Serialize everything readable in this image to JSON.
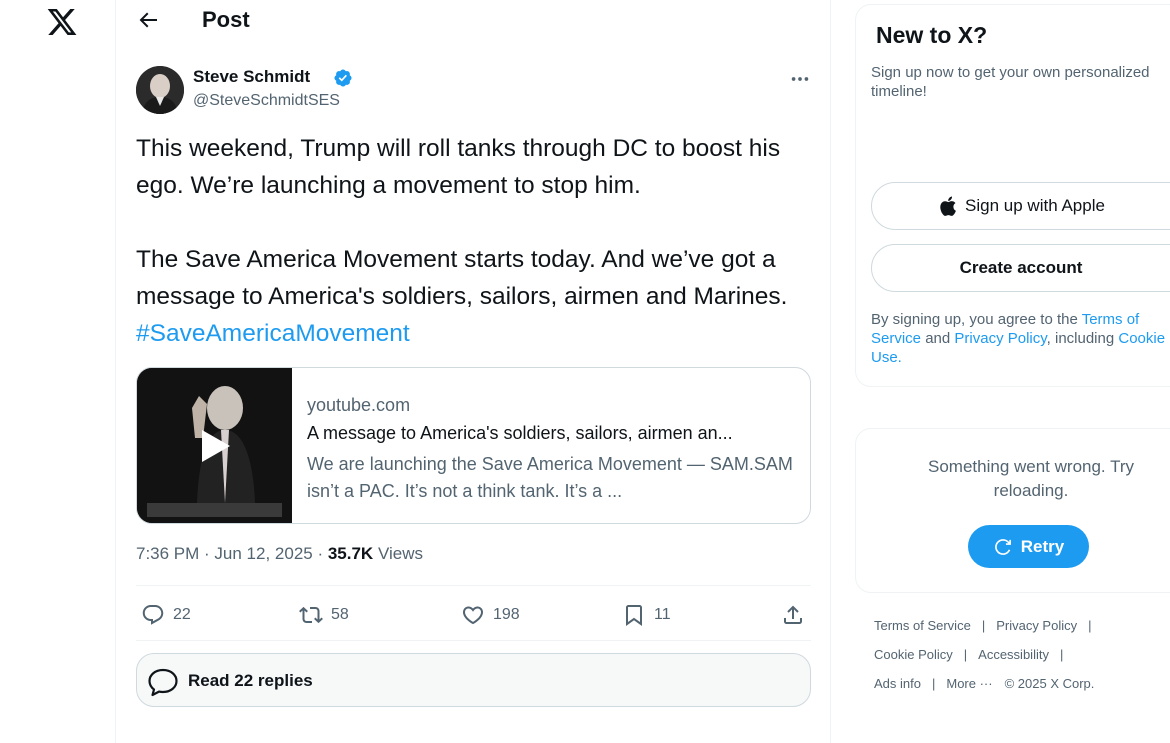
{
  "header": {
    "title": "Post"
  },
  "tweet": {
    "author_name": "Steve Schmidt",
    "author_handle": "@SteveSchmidtSES",
    "paragraph1": "This weekend, Trump will roll tanks through DC to boost his ego. We’re launching a movement to stop him.",
    "paragraph2": "The Save America Movement starts today. And we’ve got a message to America's soldiers, sailors, airmen and Marines.",
    "hashtag": "#SaveAmericaMovement",
    "time": "7:36 PM · Jun 12, 2025 · ",
    "views_count": "35.7K",
    "views_label": " Views",
    "card": {
      "domain": "youtube.com",
      "title": "A message to America's soldiers, sailors, airmen an...",
      "description": "We are launching the Save America Movement — SAM.SAM isn’t a PAC. It’s not a think tank. It’s a ..."
    },
    "actions": {
      "replies": "22",
      "reposts": "58",
      "likes": "198",
      "bookmarks": "11"
    },
    "read_replies": "Read 22 replies"
  },
  "signup": {
    "title": "New to X?",
    "subtitle": "Sign up now to get your own personalized timeline!",
    "apple_button": "Sign up with Apple",
    "create_button": "Create account",
    "legal_prefix": "By signing up, you agree to the ",
    "terms_link": "Terms of Service",
    "legal_and": " and ",
    "privacy_link": "Privacy Policy",
    "legal_including": ", including ",
    "cookie_link": "Cookie Use."
  },
  "error": {
    "message": "Something went wrong. Try reloading.",
    "retry_button": "Retry"
  },
  "footer": {
    "terms": "Terms of Service",
    "privacy": "Privacy Policy",
    "cookie": "Cookie Policy",
    "accessibility": "Accessibility",
    "ads": "Ads info",
    "more": "More ···",
    "copyright": "© 2025 X Corp.",
    "separator": "|"
  },
  "colors": {
    "accent": "#1d9bf0",
    "text_primary": "#0f1419",
    "text_secondary": "#536471"
  },
  "icons": [
    "x-logo-icon",
    "back-arrow-icon",
    "verified-badge-icon",
    "more-icon",
    "play-icon",
    "reply-icon",
    "repost-icon",
    "like-icon",
    "bookmark-icon",
    "share-icon",
    "replies-bubble-icon",
    "apple-icon",
    "retry-icon"
  ]
}
